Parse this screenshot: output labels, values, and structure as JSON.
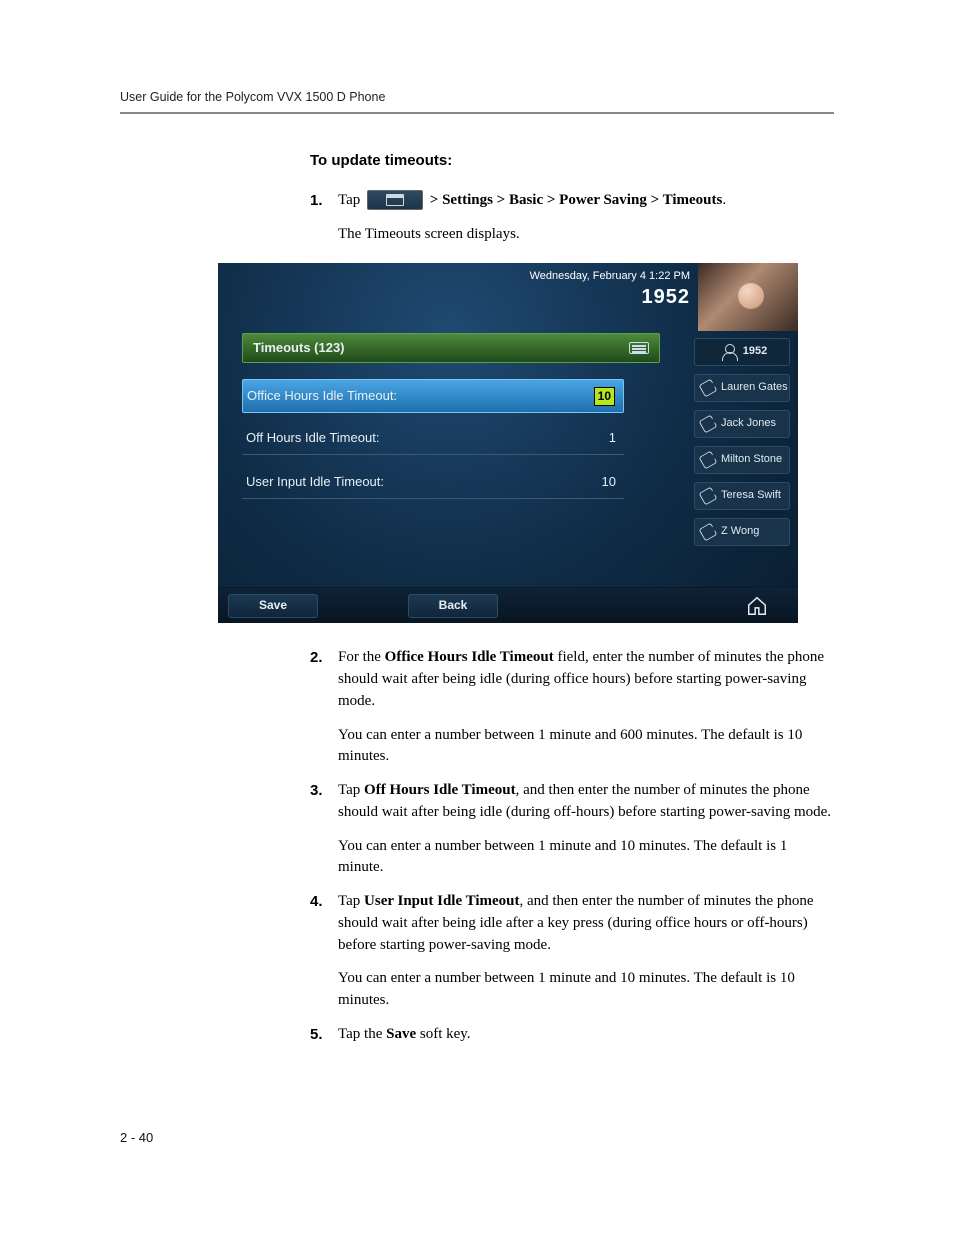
{
  "header": {
    "running": "User Guide for the Polycom VVX 1500 D Phone"
  },
  "section_lead": "To update timeouts:",
  "steps": {
    "s1": {
      "num": "1.",
      "pre": "Tap ",
      "post_bold": " > Settings > Basic > Power Saving > Timeouts",
      "post_plain": ".",
      "after": "The Timeouts screen displays."
    },
    "s2": {
      "num": "2.",
      "p1_a": "For the ",
      "p1_b_bold": "Office Hours Idle Timeout",
      "p1_c": " field, enter the number of minutes the phone should wait after being idle (during office hours) before starting power-saving mode.",
      "p2": "You can enter a number between 1 minute and 600 minutes. The default is 10 minutes."
    },
    "s3": {
      "num": "3.",
      "p1_a": "Tap ",
      "p1_b_bold": "Off Hours Idle Timeout",
      "p1_c": ", and then enter the number of minutes the phone should wait after being idle (during off-hours) before starting power-saving mode.",
      "p2": "You can enter a number between 1 minute and 10 minutes. The default is 1 minute."
    },
    "s4": {
      "num": "4.",
      "p1_a": "Tap ",
      "p1_b_bold": "User Input Idle Timeout",
      "p1_c": ", and then enter the number of minutes the phone should wait after being idle after a key press (during office hours or off-hours) before starting power-saving mode.",
      "p2": "You can enter a number between 1 minute and 10 minutes. The default is 10 minutes."
    },
    "s5": {
      "num": "5.",
      "p1_a": "Tap the ",
      "p1_b_bold": "Save",
      "p1_c": " soft key."
    }
  },
  "phone": {
    "datetime": "Wednesday, February 4  1:22 PM",
    "ext": "1952",
    "title": "Timeouts (123)",
    "rows": [
      {
        "label": "Office Hours Idle Timeout:",
        "value": "10",
        "selected": true
      },
      {
        "label": "Off Hours Idle Timeout:",
        "value": "1",
        "selected": false
      },
      {
        "label": "User Input Idle Timeout:",
        "value": "10",
        "selected": false
      }
    ],
    "side": [
      {
        "label": "1952",
        "type": "self"
      },
      {
        "label": "Lauren Gates",
        "type": "contact"
      },
      {
        "label": "Jack Jones",
        "type": "contact"
      },
      {
        "label": "Milton Stone",
        "type": "contact"
      },
      {
        "label": "Teresa Swift",
        "type": "contact"
      },
      {
        "label": "Z Wong",
        "type": "contact"
      }
    ],
    "softkeys": {
      "save": "Save",
      "back": "Back"
    }
  },
  "page_number": "2 - 40"
}
